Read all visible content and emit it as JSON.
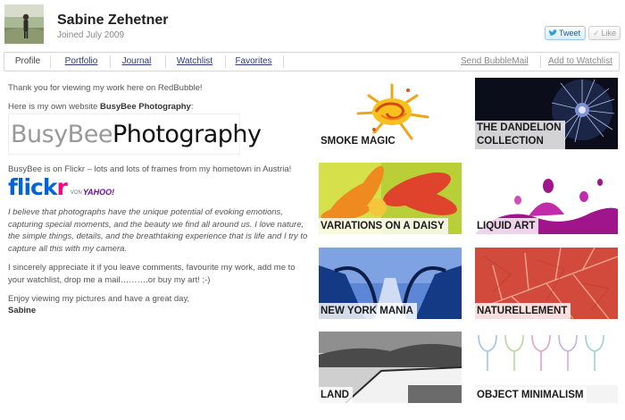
{
  "profile": {
    "name": "Sabine Zehetner",
    "joined": "Joined July 2009",
    "avatar_icon": "avatar-photo"
  },
  "social": {
    "tweet_label": "Tweet",
    "like_label": "Like"
  },
  "nav": {
    "tabs": [
      {
        "label": "Profile",
        "active": true
      },
      {
        "label": "Portfolio",
        "active": false
      },
      {
        "label": "Journal",
        "active": false
      },
      {
        "label": "Watchlist",
        "active": false
      },
      {
        "label": "Favorites",
        "active": false
      }
    ],
    "send_bubblemail": "Send BubbleMail",
    "add_to_watchlist": "Add to Watchlist"
  },
  "about": {
    "p1": "Thank you for viewing my work here on RedBubble!",
    "p2_prefix": "Here is my own website ",
    "p2_bold": "BusyBee Photography",
    "p2_suffix": ":",
    "busybee_logo": {
      "part1": "BusyBee",
      "part2": " Photography"
    },
    "p3_prefix": "BusyBee is on Flickr – lots and lots of frames from my hometown in Austria!",
    "flickr_logo": {
      "blue": "flick",
      "pink": "r",
      "von": "VON",
      "yahoo": "YAHOO!"
    },
    "p4": "I believe that photographs have the unique potential of evoking emotions, capturing special moments, and the beauty we find all around us. I love nature, the simple things, details, and the breathtaking experience that is life and I try to capture all this with my camera.",
    "p5": "I sincerely appreciate it if you leave comments, favourite my work, add me to your watchlist, drop me a mail……….or buy my art! ;-)",
    "p6": "Enjoy viewing my pictures and have a great day,",
    "signature": "Sabine"
  },
  "gallery": [
    {
      "title": "SMOKE MAGIC"
    },
    {
      "title_line1": "THE DANDELION",
      "title_line2": "COLLECTION"
    },
    {
      "title": "VARIATIONS ON A DAISY"
    },
    {
      "title": "LIQUID ART"
    },
    {
      "title": "NEW YORK MANIA"
    },
    {
      "title": "NATURELLEMENT"
    },
    {
      "title": "LAND"
    },
    {
      "title": "OBJECT MINIMALISM"
    }
  ]
}
